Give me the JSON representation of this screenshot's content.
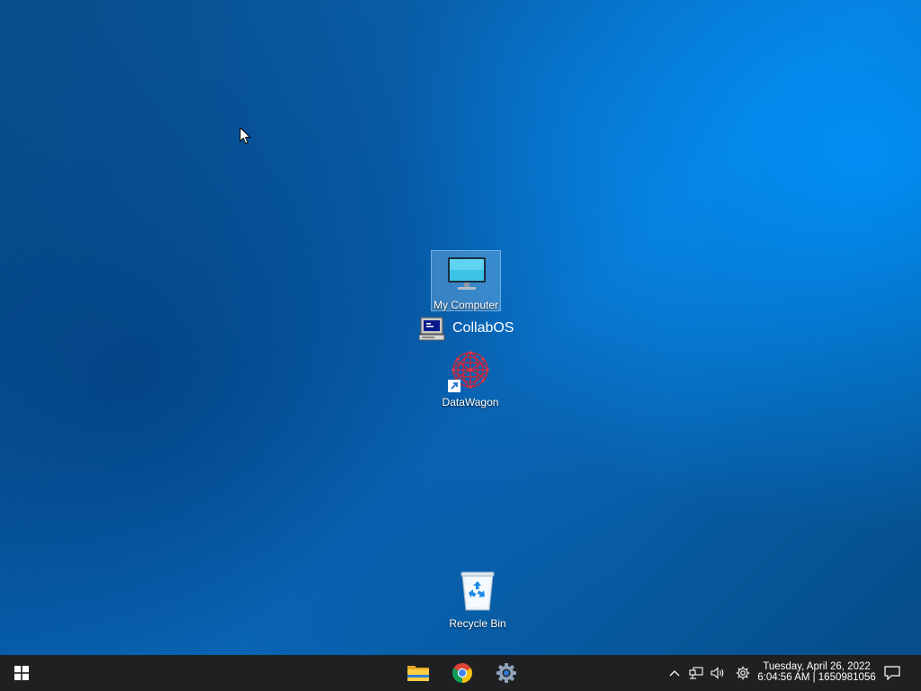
{
  "desktop": {
    "icons": [
      {
        "label": "My Computer",
        "icon": "monitor-icon"
      },
      {
        "label": "CollabOS",
        "icon": "terminal-computer-icon"
      },
      {
        "label": "DataWagon",
        "icon": "red-network-sphere-icon"
      },
      {
        "label": "Recycle Bin",
        "icon": "recycle-bin-icon"
      }
    ]
  },
  "taskbar": {
    "pinned": [
      {
        "icon": "file-explorer-icon"
      },
      {
        "icon": "chrome-icon"
      },
      {
        "icon": "settings-gear-icon"
      }
    ],
    "tray": {
      "icons": [
        "chevron-up-icon",
        "network-icon",
        "volume-icon",
        "settings-icon"
      ],
      "date": "Tuesday, April 26, 2022",
      "time": "6:04:56 AM | 1650981056"
    }
  },
  "colors": {
    "taskbar": "#1f2022",
    "selection": "#96c8f0",
    "accent": "#0078d7"
  }
}
